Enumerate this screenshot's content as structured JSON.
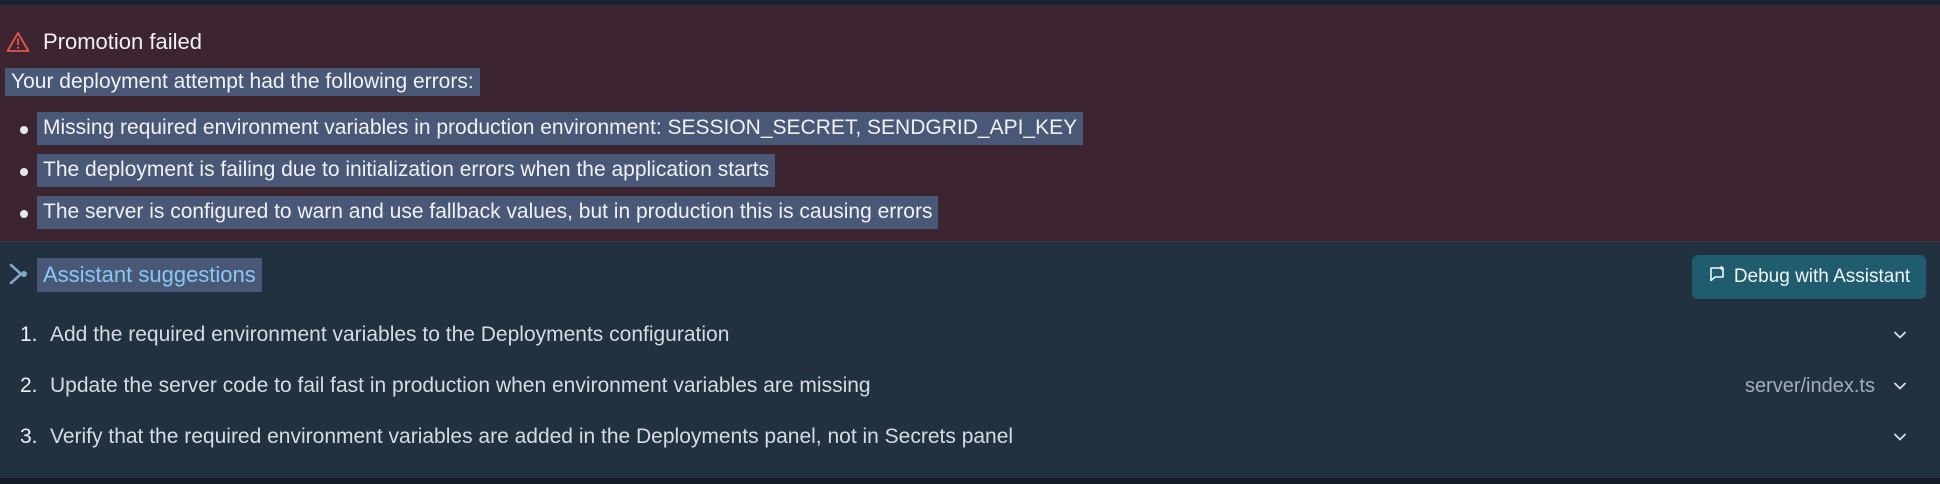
{
  "error": {
    "title": "Promotion failed",
    "intro": "Your deployment attempt had the following errors:",
    "items": [
      "Missing required environment variables in production environment: SESSION_SECRET, SENDGRID_API_KEY",
      "The deployment is failing due to initialization errors when the application starts",
      "The server is configured to warn and use fallback values, but in production this is causing errors"
    ],
    "icon": "warning-icon",
    "color": "#e5534b"
  },
  "assistant": {
    "title": "Assistant suggestions",
    "debug_button": "Debug with Assistant",
    "accent": "#1f5d6e",
    "suggestions": [
      {
        "number": "1.",
        "text": "Add the required environment variables to the Deployments configuration",
        "file": ""
      },
      {
        "number": "2.",
        "text": "Update the server code to fail fast in production when environment variables are missing",
        "file": "server/index.ts"
      },
      {
        "number": "3.",
        "text": "Verify that the required environment variables are added in the Deployments panel, not in Secrets panel",
        "file": ""
      }
    ]
  }
}
